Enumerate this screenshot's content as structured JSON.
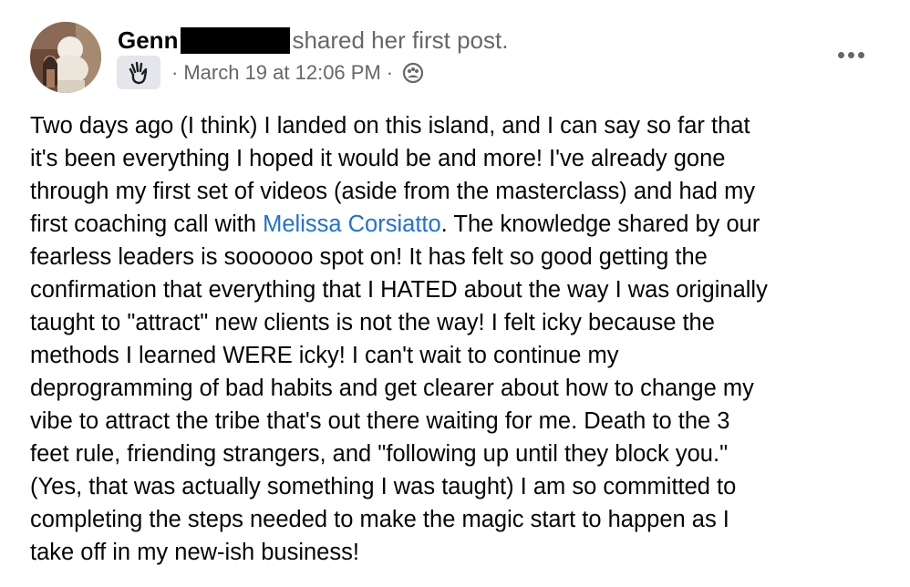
{
  "post": {
    "author": "Genn",
    "action": "shared her first post.",
    "timestamp": "March 19 at 12:06 PM",
    "separator": "·",
    "badge_icon": "wave-hand-icon",
    "audience_icon": "group-icon",
    "more_icon": "more-options-icon",
    "mention": "Melissa Corsiatto",
    "mention_color": "#216fdb",
    "text_lines": {
      "l1": "Two days ago (I think) I landed on this island, and I can say so far that",
      "l2": "it's been everything I hoped it would be and more! I've already gone",
      "l3": "through my first set of videos (aside from the masterclass) and had my",
      "l4_before": "first coaching call with ",
      "l4_after": ". The knowledge shared by our",
      "l5": "fearless leaders is soooooo spot on! It has felt so good getting the",
      "l6": "confirmation that everything that I HATED about the way I was originally",
      "l7": "taught to \"attract\" new clients is not the way! I felt icky because the",
      "l8": "methods I learned WERE icky! I can't wait to continue my",
      "l9": "deprogramming of bad habits and get clearer about how to change my",
      "l10": "vibe to attract the tribe that's out there waiting for me. Death to the 3",
      "l11": "feet rule, friending strangers, and \"following up until they block you.\"",
      "l12": "(Yes, that was actually something I was taught) I am so committed to",
      "l13": "completing the steps needed to make the magic start to happen as I",
      "l14": "take off in my new-ish business!"
    }
  }
}
